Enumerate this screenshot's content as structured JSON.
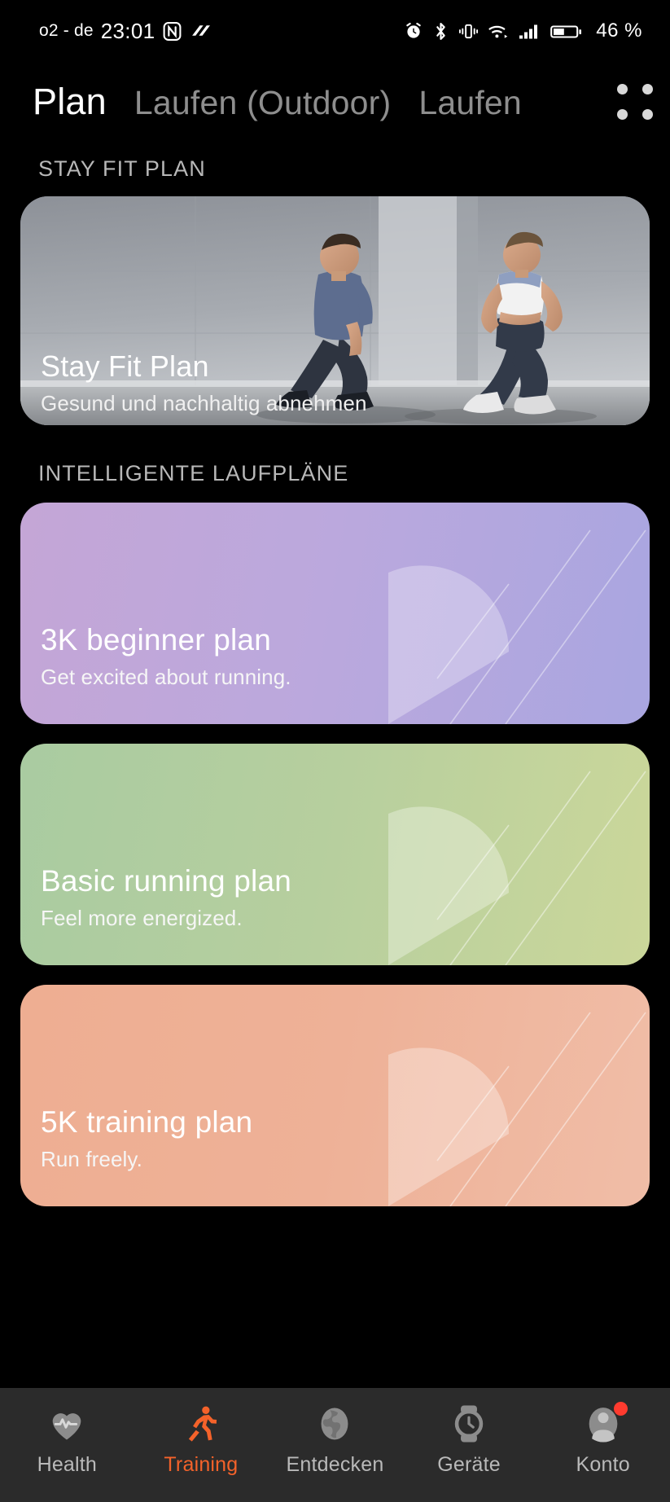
{
  "status_bar": {
    "carrier": "o2 - de",
    "time": "23:01",
    "battery_percent": "46 %",
    "icons_left": [
      "nfc-icon",
      "data-saver-icon"
    ],
    "icons_right": [
      "alarm-icon",
      "bluetooth-icon",
      "vibrate-icon",
      "wifi-icon",
      "cellular-signal-icon",
      "battery-icon"
    ]
  },
  "header": {
    "tabs": [
      {
        "label": "Plan",
        "active": true
      },
      {
        "label": "Laufen (Outdoor)",
        "active": false
      },
      {
        "label": "Laufen",
        "active": false
      }
    ],
    "menu_icon": "grid-menu-icon"
  },
  "sections": {
    "stay_fit_heading": "STAY FIT PLAN",
    "smart_plans_heading": "INTELLIGENTE LAUFPLÄNE"
  },
  "stay_fit_card": {
    "title": "Stay Fit Plan",
    "subtitle": "Gesund und nachhaltig abnehmen"
  },
  "plans": [
    {
      "title": "3K beginner plan",
      "subtitle": "Get excited about running.",
      "color": "#b9a7dc",
      "theme": "purple"
    },
    {
      "title": "Basic running plan",
      "subtitle": "Feel more energized.",
      "color": "#b6cf9f",
      "theme": "green"
    },
    {
      "title": "5K training plan",
      "subtitle": "Run freely.",
      "color": "#eeb196",
      "theme": "peach"
    }
  ],
  "bottom_nav": {
    "accent_color": "#f4622a",
    "items": [
      {
        "label": "Health",
        "icon": "heart-pulse-icon",
        "active": false,
        "badge": false
      },
      {
        "label": "Training",
        "icon": "running-person-icon",
        "active": true,
        "badge": false
      },
      {
        "label": "Entdecken",
        "icon": "globe-icon",
        "active": false,
        "badge": false
      },
      {
        "label": "Geräte",
        "icon": "watch-icon",
        "active": false,
        "badge": false
      },
      {
        "label": "Konto",
        "icon": "account-person-icon",
        "active": false,
        "badge": true
      }
    ]
  }
}
